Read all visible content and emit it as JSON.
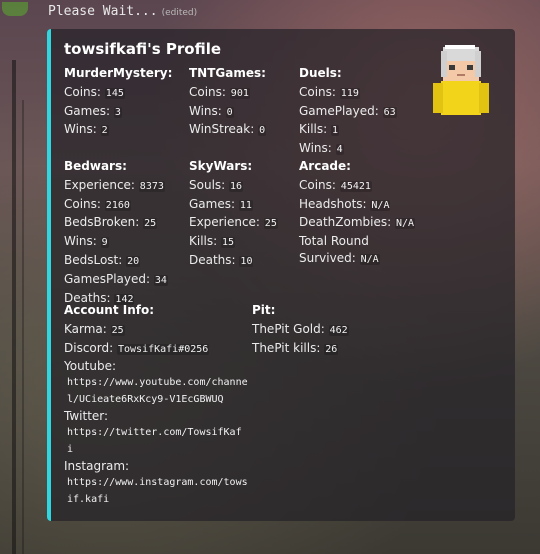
{
  "message": {
    "header": "Please Wait...",
    "edited": "(edited)"
  },
  "embed": {
    "title": "towsifkafi's Profile",
    "accent_color": "#2fd8e0",
    "thumbnail_icon": "minecraft-skin-icon",
    "fields": {
      "murdermystery": {
        "name": "MurderMystery:",
        "rows": [
          {
            "label": "Coins:",
            "value": "145"
          },
          {
            "label": "Games:",
            "value": "3"
          },
          {
            "label": "Wins:",
            "value": "2"
          }
        ]
      },
      "tntgames": {
        "name": "TNTGames:",
        "rows": [
          {
            "label": "Coins:",
            "value": "901"
          },
          {
            "label": "Wins:",
            "value": "0"
          },
          {
            "label": "WinStreak:",
            "value": "0"
          }
        ]
      },
      "duels": {
        "name": "Duels:",
        "rows": [
          {
            "label": "Coins:",
            "value": "119"
          },
          {
            "label": "GamePlayed:",
            "value": "63"
          },
          {
            "label": "Kills:",
            "value": "1"
          },
          {
            "label": "Wins:",
            "value": "4"
          }
        ]
      },
      "bedwars": {
        "name": "Bedwars:",
        "rows": [
          {
            "label": "Experience:",
            "value": "8373"
          },
          {
            "label": "Coins:",
            "value": "2160"
          },
          {
            "label": "BedsBroken:",
            "value": "25"
          },
          {
            "label": "Wins:",
            "value": "9"
          },
          {
            "label": "BedsLost:",
            "value": "20"
          },
          {
            "label": "GamesPlayed:",
            "value": "34"
          },
          {
            "label": "Deaths:",
            "value": "142"
          }
        ]
      },
      "skywars": {
        "name": "SkyWars:",
        "rows": [
          {
            "label": "Souls:",
            "value": "16"
          },
          {
            "label": "Games:",
            "value": "11"
          },
          {
            "label": "Experience:",
            "value": "25"
          },
          {
            "label": "Kills:",
            "value": "15"
          },
          {
            "label": "Deaths:",
            "value": "10"
          }
        ]
      },
      "arcade": {
        "name": "Arcade:",
        "rows": [
          {
            "label": "Coins:",
            "value": "45421"
          },
          {
            "label": "Headshots:",
            "value": "N/A"
          },
          {
            "label": "DeathZombies:",
            "value": "N/A"
          },
          {
            "label": "Total Round",
            "value": ""
          },
          {
            "label": "Survived:",
            "value": "N/A"
          }
        ]
      },
      "account": {
        "name": "Account Info:",
        "karma_label": "Karma:",
        "karma": "25",
        "discord_label": "Discord:",
        "discord": "TowsifKafi#0256",
        "youtube_label": "Youtube:",
        "youtube_line1": "https://www.youtube.com/channe",
        "youtube_line2": "l/UCieate6RxKcy9-V1EcGBWUQ",
        "twitter_label": "Twitter:",
        "twitter_line1": "https://twitter.com/TowsifKaf",
        "twitter_line2": "i",
        "instagram_label": "Instagram:",
        "instagram_line1": "https://www.instagram.com/tows",
        "instagram_line2": "if.kafi"
      },
      "pit": {
        "name": "Pit:",
        "rows": [
          {
            "label": "ThePit Gold:",
            "value": "462"
          },
          {
            "label": "ThePit kills:",
            "value": "26"
          }
        ]
      }
    }
  }
}
